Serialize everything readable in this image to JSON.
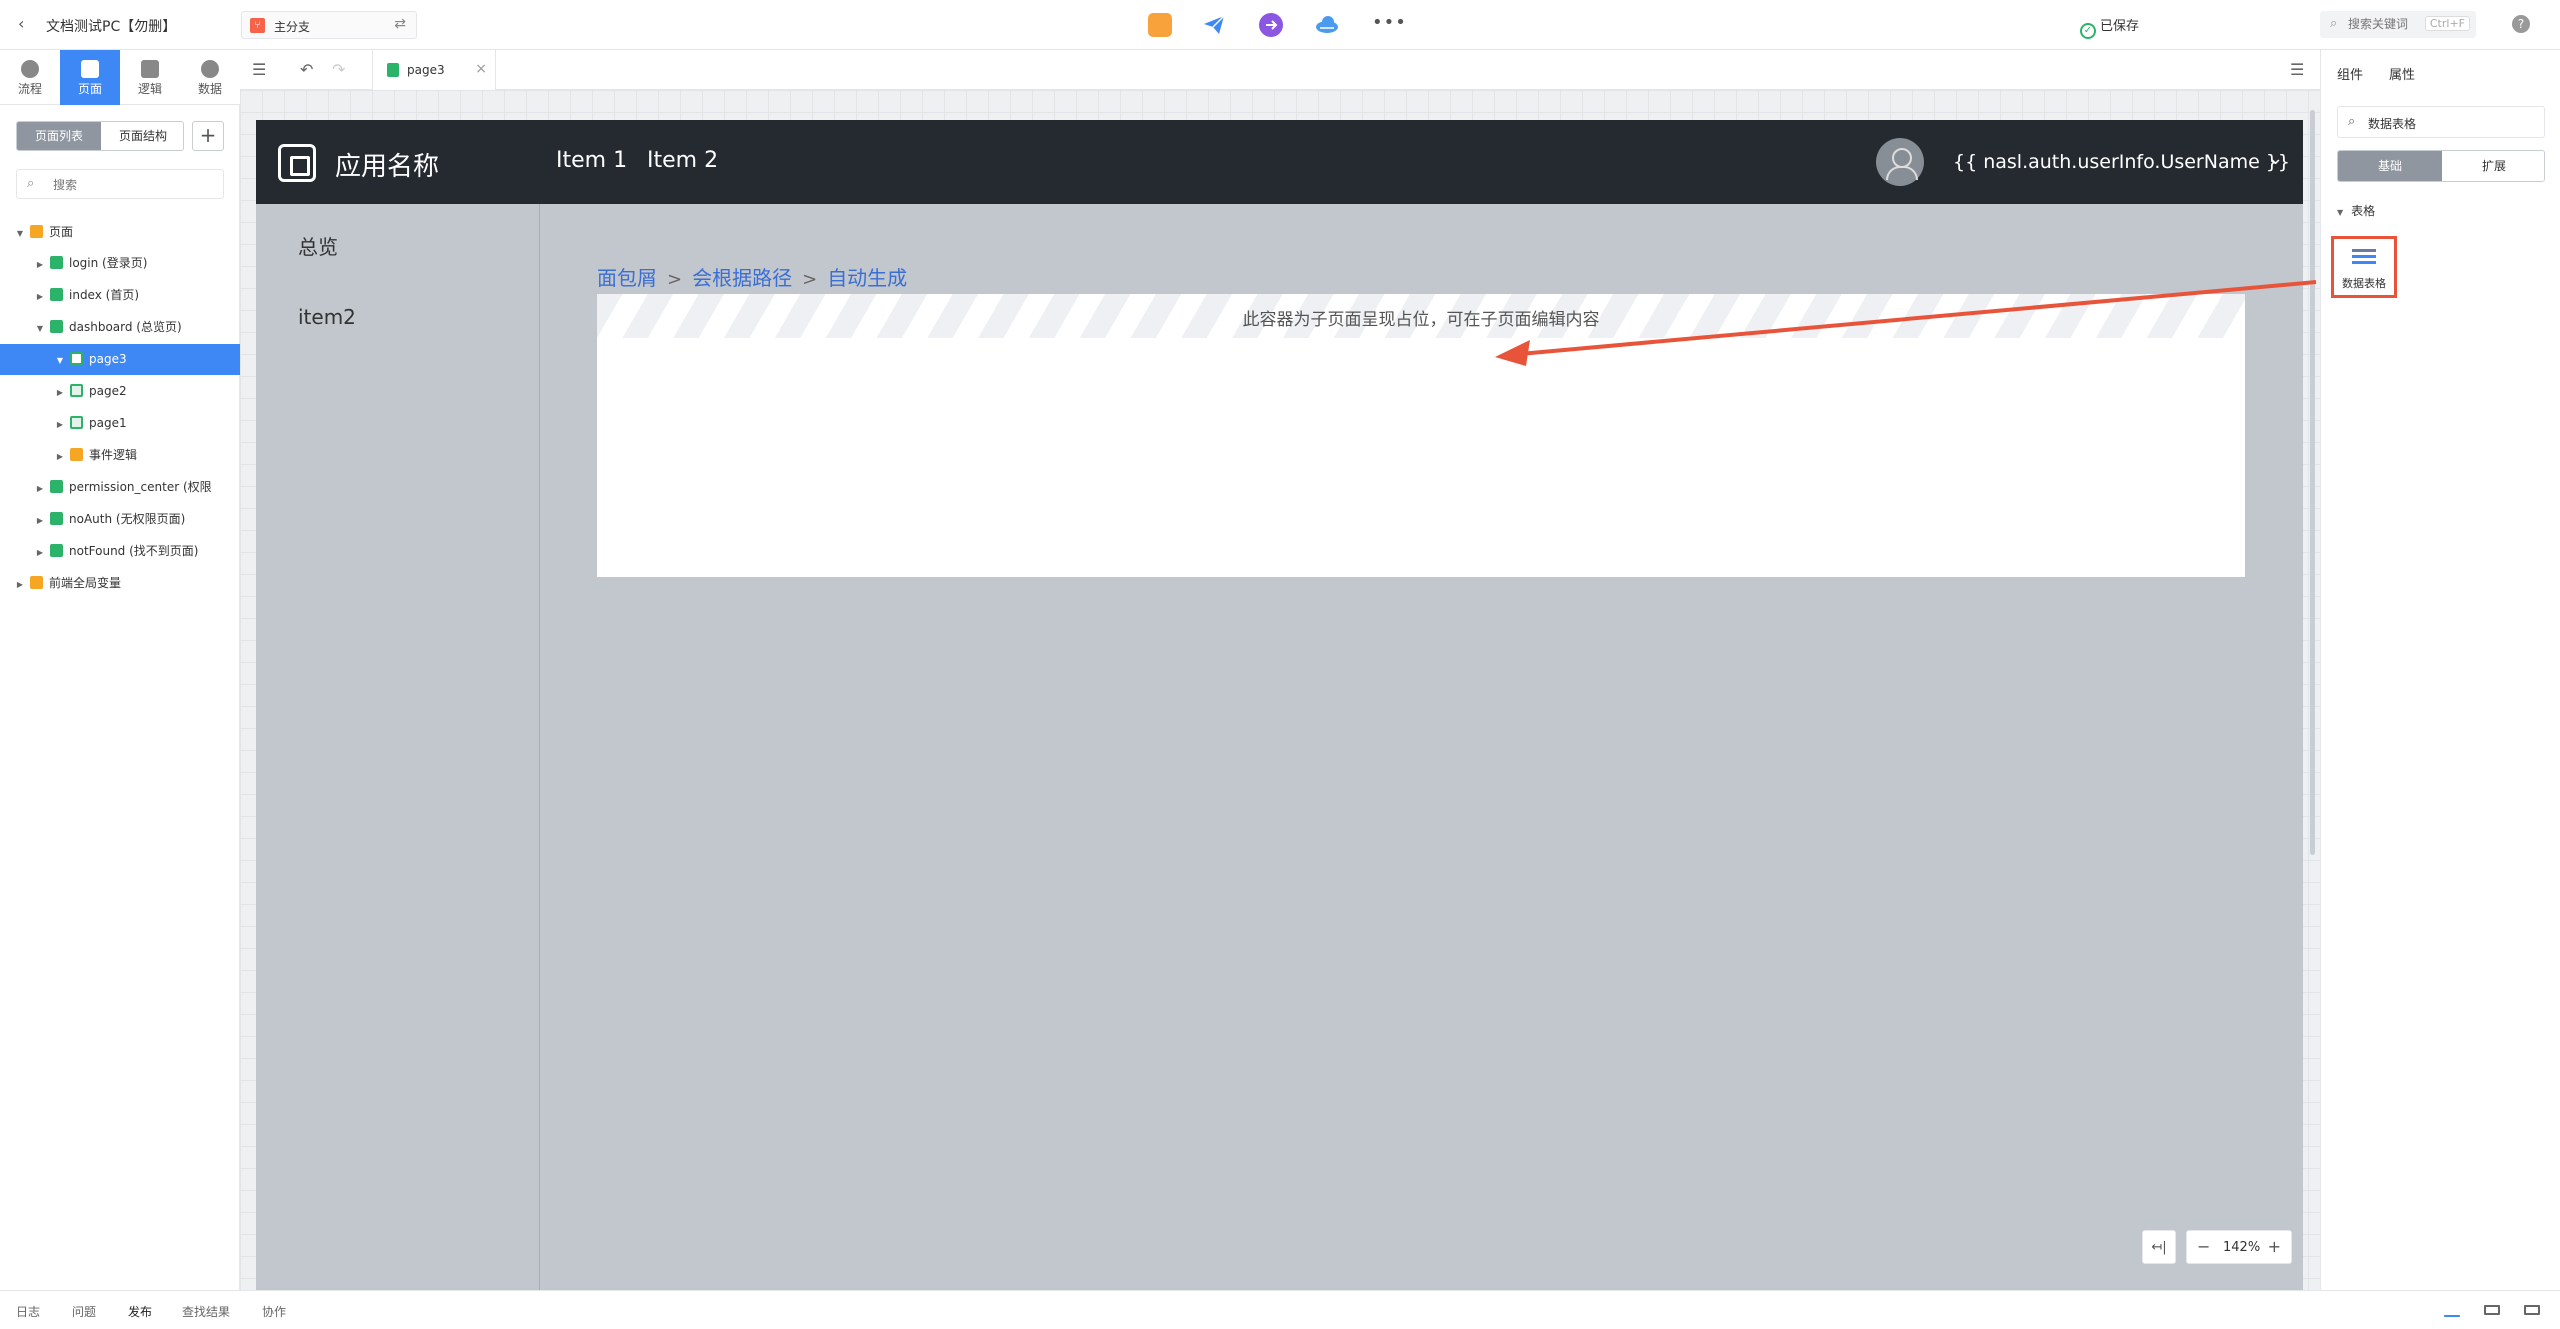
{
  "topbar": {
    "app_title": "文档测试PC【勿删】",
    "branch_label": "主分支",
    "saved_status": "已保存",
    "search_placeholder": "搜索关键词",
    "search_shortcut": "Ctrl+F",
    "help": "?"
  },
  "rail": {
    "items": [
      {
        "label": "流程"
      },
      {
        "label": "页面"
      },
      {
        "label": "逻辑"
      },
      {
        "label": "数据"
      }
    ],
    "active": "页面"
  },
  "leftpanel": {
    "tabs": [
      "页面列表",
      "页面结构"
    ],
    "add": "+",
    "search_placeholder": "搜索",
    "tree": [
      {
        "label": "页面"
      },
      {
        "label": "login (登录页)"
      },
      {
        "label": "index (首页)"
      },
      {
        "label": "dashboard (总览页)"
      },
      {
        "label": "page3"
      },
      {
        "label": "page2"
      },
      {
        "label": "page1"
      },
      {
        "label": "事件逻辑"
      },
      {
        "label": "permission_center (权限"
      },
      {
        "label": "noAuth (无权限页面)"
      },
      {
        "label": "notFound (找不到页面)"
      },
      {
        "label": "前端全局变量"
      }
    ]
  },
  "editor": {
    "open_tab": "page3",
    "zoom": "142%",
    "fit": "↤|"
  },
  "app": {
    "name": "应用名称",
    "nav": [
      "Item 1",
      "Item 2"
    ],
    "username": "{{ nasl.auth.userInfo.UserName }}",
    "menu": [
      "总览",
      "item2"
    ],
    "breadcrumb": [
      "面包屑",
      "会根据路径",
      "自动生成"
    ],
    "placeholder_text": "此容器为子页面呈现占位，可在子页面编辑内容"
  },
  "rightpanel": {
    "tabs": [
      "组件",
      "属性"
    ],
    "search_value": "数据表格",
    "segments": [
      "基础",
      "扩展"
    ],
    "category": "表格",
    "component_label": "数据表格"
  },
  "bottombar": {
    "tabs": [
      "日志",
      "问题",
      "发布",
      "查找结果",
      "协作"
    ],
    "active": "发布"
  },
  "colors": {
    "accent": "#3e88f6",
    "app_nav_bg": "#252a31",
    "highlight": "#e8543a",
    "link": "#3a6fd4"
  }
}
